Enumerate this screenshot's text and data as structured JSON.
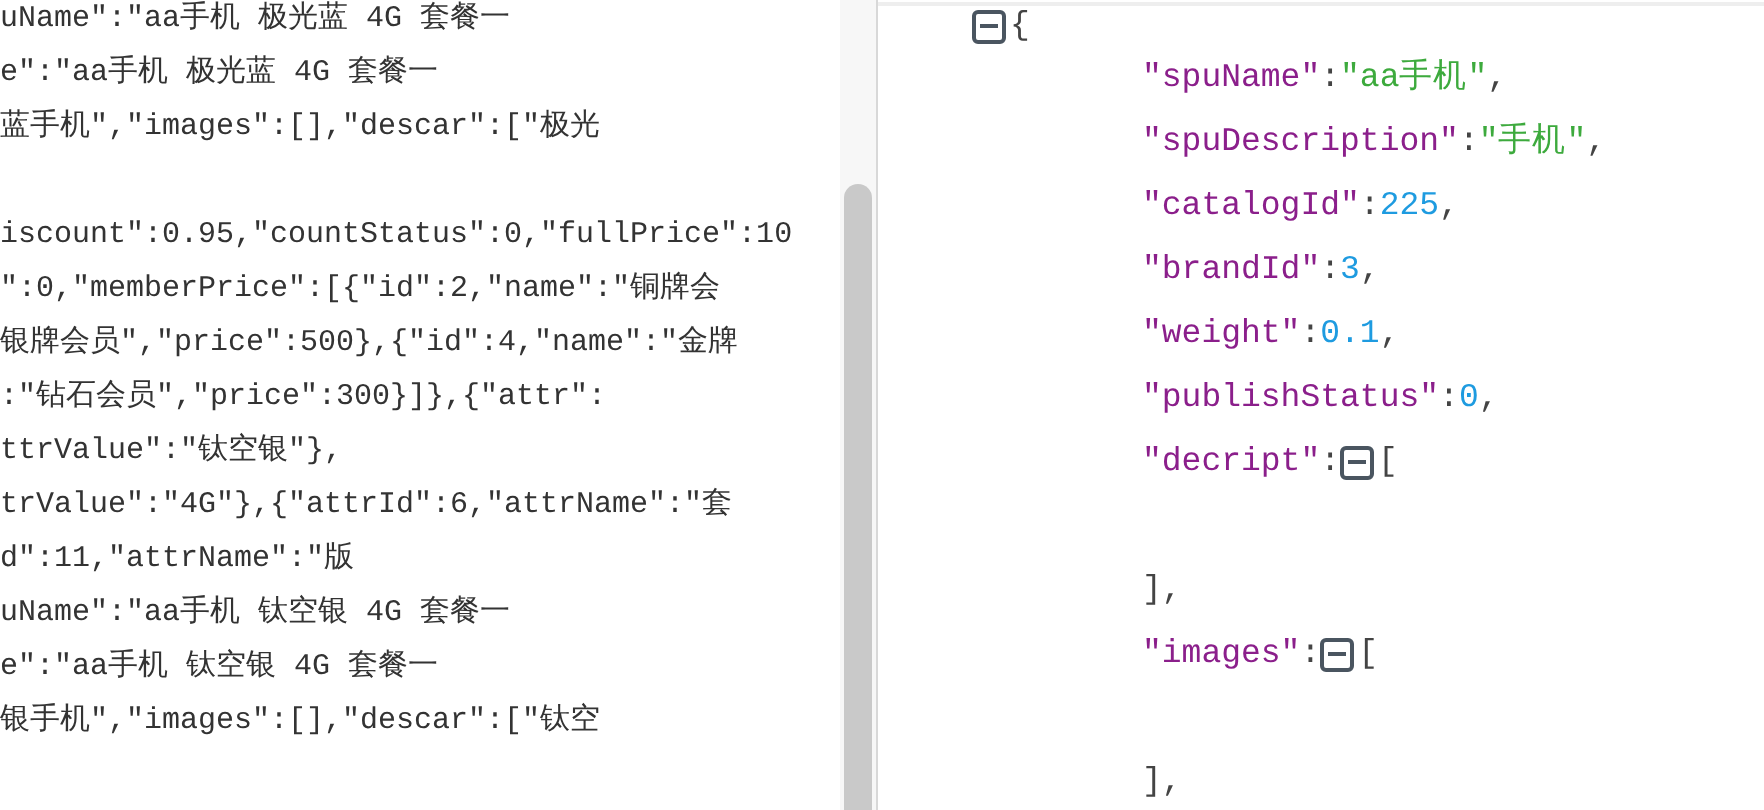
{
  "raw_pane": {
    "lines": [
      {
        "kind": "text",
        "text": "uName\":\"aa手机 极光蓝 4G 套餐一"
      },
      {
        "kind": "text",
        "text": "e\":\"aa手机 极光蓝 4G 套餐一"
      },
      {
        "kind": "text",
        "text": "蓝手机\",\"images\":[],\"descar\":[\"极光"
      },
      {
        "kind": "blank"
      },
      {
        "kind": "text",
        "text": "iscount\":0.95,\"countStatus\":0,\"fullPrice\":10"
      },
      {
        "kind": "text",
        "text": "\":0,\"memberPrice\":[{\"id\":2,\"name\":\"铜牌会"
      },
      {
        "kind": "text",
        "text": "银牌会员\",\"price\":500},{\"id\":4,\"name\":\"金牌"
      },
      {
        "kind": "text",
        "text": ":\"钻石会员\",\"price\":300}]},{\"attr\":"
      },
      {
        "kind": "text",
        "text": "ttrValue\":\"钛空银\"},"
      },
      {
        "kind": "text",
        "text": "trValue\":\"4G\"},{\"attrId\":6,\"attrName\":\"套"
      },
      {
        "kind": "text",
        "text": "d\":11,\"attrName\":\"版"
      },
      {
        "kind": "text",
        "text": "uName\":\"aa手机 钛空银 4G 套餐一"
      },
      {
        "kind": "text",
        "text": "e\":\"aa手机 钛空银 4G 套餐一"
      },
      {
        "kind": "text",
        "text": "银手机\",\"images\":[],\"descar\":[\"钛空"
      }
    ]
  },
  "tree_pane": {
    "root": {
      "open": "{",
      "expanded": true,
      "children": [
        {
          "kind": "string",
          "key": "\"spuName\"",
          "colon": ":",
          "value": "\"aa手机\"",
          "comma": ","
        },
        {
          "kind": "string",
          "key": "\"spuDescription\"",
          "colon": ":",
          "value": "\"手机\"",
          "comma": ","
        },
        {
          "kind": "number",
          "key": "\"catalogId\"",
          "colon": ":",
          "value": "225",
          "comma": ","
        },
        {
          "kind": "number",
          "key": "\"brandId\"",
          "colon": ":",
          "value": "3",
          "comma": ","
        },
        {
          "kind": "number",
          "key": "\"weight\"",
          "colon": ":",
          "value": "0.1",
          "comma": ","
        },
        {
          "kind": "number",
          "key": "\"publishStatus\"",
          "colon": ":",
          "value": "0",
          "comma": ","
        },
        {
          "kind": "array",
          "key": "\"decript\"",
          "colon": ":",
          "open": "[",
          "expanded": true,
          "close": "],"
        },
        {
          "kind": "array",
          "key": "\"images\"",
          "colon": ":",
          "open": "[",
          "expanded": true,
          "close": "],"
        }
      ]
    }
  }
}
